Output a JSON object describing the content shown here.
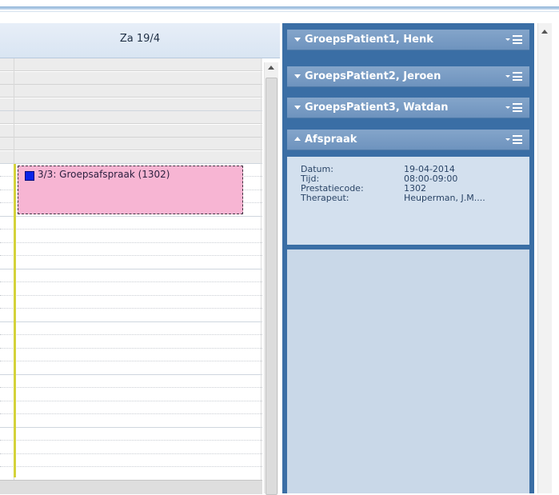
{
  "calendar": {
    "day_header": "Za 19/4",
    "appointment": {
      "label": "3/3: Groepsafspraak (1302)",
      "fill_color": "#f7b5d3",
      "marker_color": "#0a22e8"
    }
  },
  "panel": {
    "groups": [
      {
        "name": "GroepsPatient1, Henk"
      },
      {
        "name": "GroepsPatient2, Jeroen"
      },
      {
        "name": "GroepsPatient3, Watdan"
      }
    ],
    "details_section": {
      "title": "Afspraak",
      "fields": [
        {
          "label": "Datum:",
          "value": "19-04-2014"
        },
        {
          "label": "Tijd:",
          "value": "08:00-09:00"
        },
        {
          "label": "Prestatiecode:",
          "value": "1302"
        },
        {
          "label": "Therapeut:",
          "value": "Heuperman, J.M...."
        }
      ]
    },
    "accent_color": "#3a6ea5",
    "icons": {
      "collapse": "triangle-down-icon",
      "expand": "triangle-up-icon",
      "menu": "dropdown-menu-icon"
    }
  }
}
